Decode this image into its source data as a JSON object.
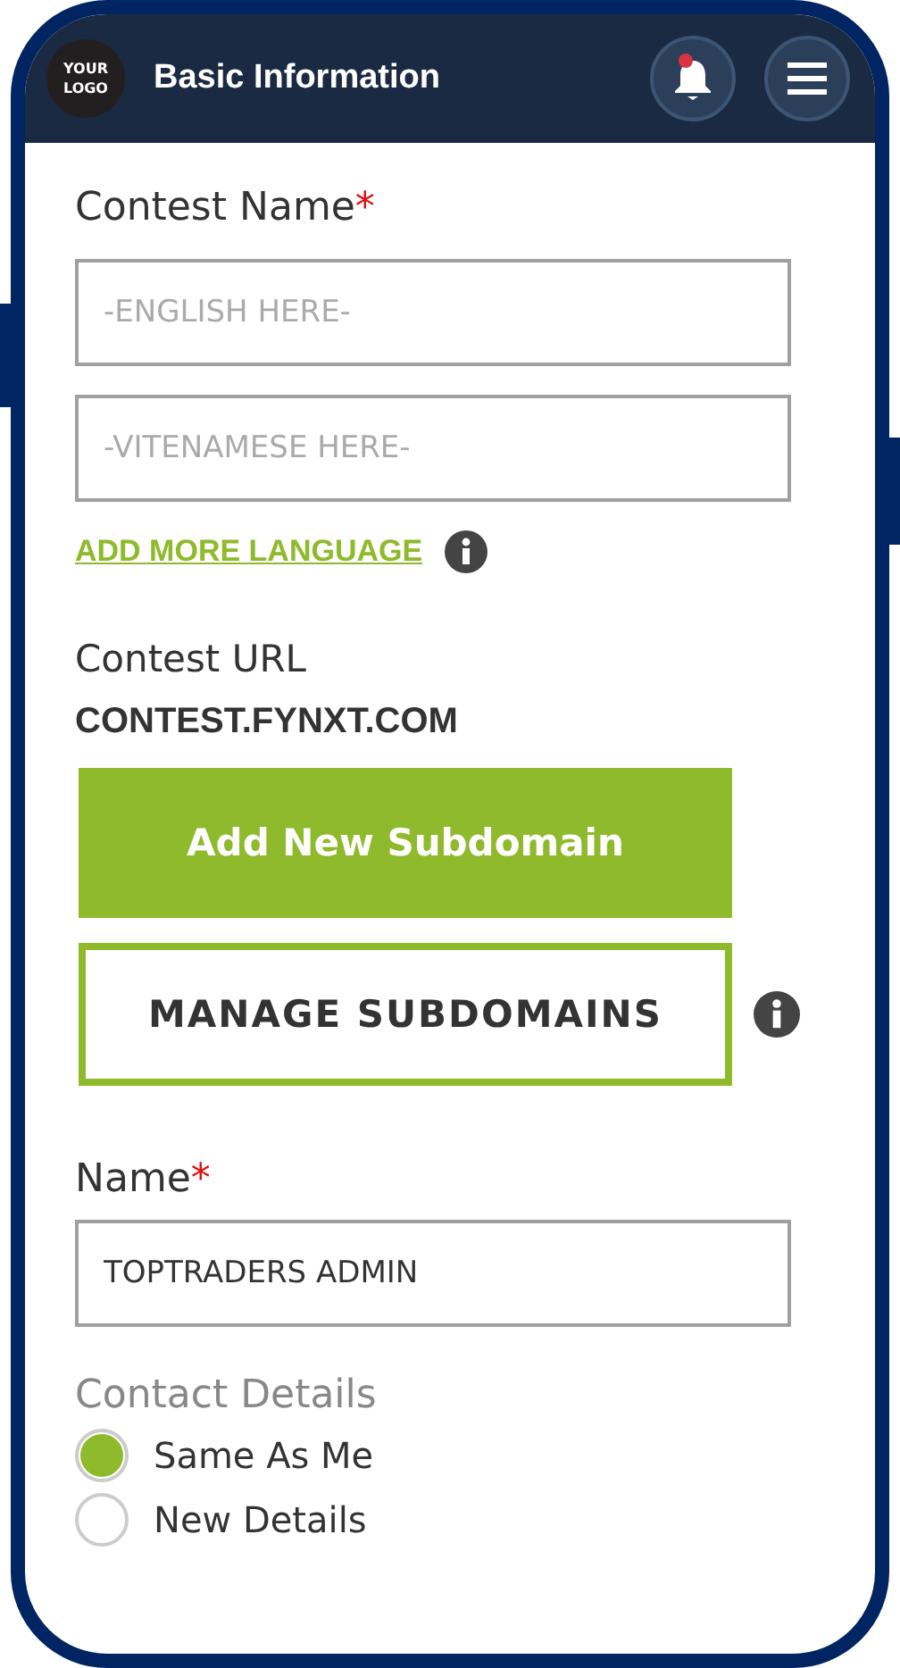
{
  "header": {
    "logo": [
      "YOUR",
      "LOGO"
    ],
    "title": "Basic Information",
    "notification_unread": true
  },
  "contest_name": {
    "label": "Contest Name",
    "required_mark": "*",
    "fields": [
      {
        "placeholder": "-ENGLISH HERE-"
      },
      {
        "placeholder": "-VITENAMESE HERE-"
      }
    ],
    "link": "ADD MORE LANGUAGE"
  },
  "contest_url": {
    "label": "Contest URL",
    "value": "CONTEST.FYNXT.COM"
  },
  "buttons": [
    {
      "kind": "primary",
      "label": "Add New Subdomain",
      "info": false
    },
    {
      "kind": "outline",
      "label": "MANAGE SUBDOMAINS",
      "info": true
    }
  ],
  "name": {
    "label": "Name",
    "required_mark": "*",
    "value": "TOPTRADERS ADMIN"
  },
  "contact_details": {
    "label": "Contact Details",
    "options": [
      {
        "label": "Same As Me",
        "selected": true
      },
      {
        "label": "New Details",
        "selected": false
      }
    ]
  }
}
